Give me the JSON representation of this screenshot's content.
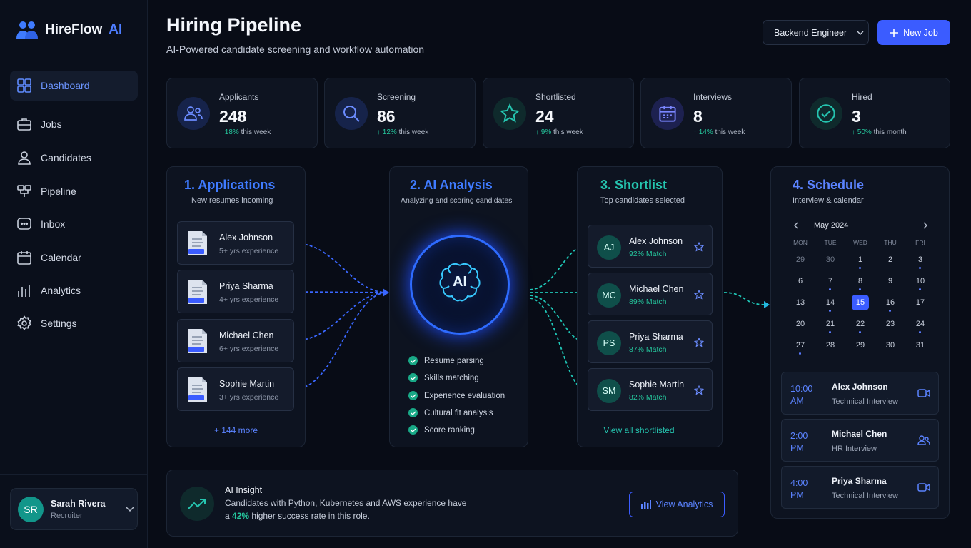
{
  "brand": {
    "name": "HireFlow",
    "suffix": "AI"
  },
  "nav": [
    {
      "label": "Dashboard",
      "icon": "dashboard-icon",
      "active": true
    },
    {
      "label": "Jobs",
      "icon": "briefcase-icon"
    },
    {
      "label": "Candidates",
      "icon": "user-icon"
    },
    {
      "label": "Pipeline",
      "icon": "pipeline-icon"
    },
    {
      "label": "Inbox",
      "icon": "inbox-icon"
    },
    {
      "label": "Calendar",
      "icon": "calendar-icon"
    },
    {
      "label": "Analytics",
      "icon": "analytics-icon"
    },
    {
      "label": "Settings",
      "icon": "gear-icon"
    }
  ],
  "user": {
    "initials": "SR",
    "name": "Sarah Rivera",
    "role": "Recruiter"
  },
  "header": {
    "title": "Hiring Pipeline",
    "subtitle": "AI-Powered candidate screening and workflow automation",
    "job_select": "Backend Engineer",
    "new_job": "New Job"
  },
  "stats": [
    {
      "label": "Applicants",
      "value": "248",
      "trend": "18%",
      "period": "this week",
      "icon": "users-icon"
    },
    {
      "label": "Screening",
      "value": "86",
      "trend": "12%",
      "period": "this week",
      "icon": "search-icon"
    },
    {
      "label": "Shortlisted",
      "value": "24",
      "trend": "9%",
      "period": "this week",
      "icon": "star-icon"
    },
    {
      "label": "Interviews",
      "value": "8",
      "trend": "14%",
      "period": "this week",
      "icon": "calendar-icon"
    },
    {
      "label": "Hired",
      "value": "3",
      "trend": "50%",
      "period": "this month",
      "icon": "check-circle-icon"
    }
  ],
  "applications": {
    "title": "1. Applications",
    "subtitle": "New resumes incoming",
    "items": [
      {
        "name": "Alex Johnson",
        "exp": "5+ yrs experience"
      },
      {
        "name": "Priya Sharma",
        "exp": "4+ yrs experience"
      },
      {
        "name": "Michael Chen",
        "exp": "6+ yrs experience"
      },
      {
        "name": "Sophie Martin",
        "exp": "3+ yrs experience"
      }
    ],
    "more": "+ 144 more"
  },
  "analysis": {
    "title": "2. AI Analysis",
    "subtitle": "Analyzing and scoring candidates",
    "badge": "AI",
    "checks": [
      "Resume parsing",
      "Skills matching",
      "Experience evaluation",
      "Cultural fit analysis",
      "Score ranking"
    ]
  },
  "shortlist": {
    "title": "3. Shortlist",
    "subtitle": "Top candidates selected",
    "items": [
      {
        "initials": "AJ",
        "name": "Alex Johnson",
        "match": "92% Match"
      },
      {
        "initials": "MC",
        "name": "Michael Chen",
        "match": "89% Match"
      },
      {
        "initials": "PS",
        "name": "Priya Sharma",
        "match": "87% Match"
      },
      {
        "initials": "SM",
        "name": "Sophie Martin",
        "match": "82% Match"
      }
    ],
    "view_all": "View all shortlisted"
  },
  "schedule": {
    "title": "4. Schedule",
    "subtitle": "Interview & calendar",
    "month": "May 2024",
    "weekdays": [
      "MON",
      "TUE",
      "WED",
      "THU",
      "FRI"
    ],
    "weeks": [
      [
        "29",
        "30",
        "1",
        "2",
        "3"
      ],
      [
        "6",
        "7",
        "8",
        "9",
        "10"
      ],
      [
        "13",
        "14",
        "15",
        "16",
        "17"
      ],
      [
        "20",
        "21",
        "22",
        "23",
        "24"
      ],
      [
        "27",
        "28",
        "29",
        "30",
        "31"
      ]
    ],
    "selected": "15",
    "events": [
      {
        "time": "10:00 AM",
        "name": "Alex Johnson",
        "type": "Technical Interview",
        "icon": "video-icon"
      },
      {
        "time": "2:00 PM",
        "name": "Michael Chen",
        "type": "HR Interview",
        "icon": "users-icon"
      },
      {
        "time": "4:00 PM",
        "name": "Priya Sharma",
        "type": "Technical Interview",
        "icon": "video-icon"
      }
    ]
  },
  "insight": {
    "title": "AI Insight",
    "line1": "Candidates with Python, Kubernetes and AWS experience have",
    "line2_pre": "a",
    "highlight": "42%",
    "line2_post": "higher success rate in this role.",
    "button": "View Analytics"
  },
  "colors": {
    "accent": "#3b5cff",
    "success": "#25c59c",
    "ai_glow": "#2e6bff"
  }
}
